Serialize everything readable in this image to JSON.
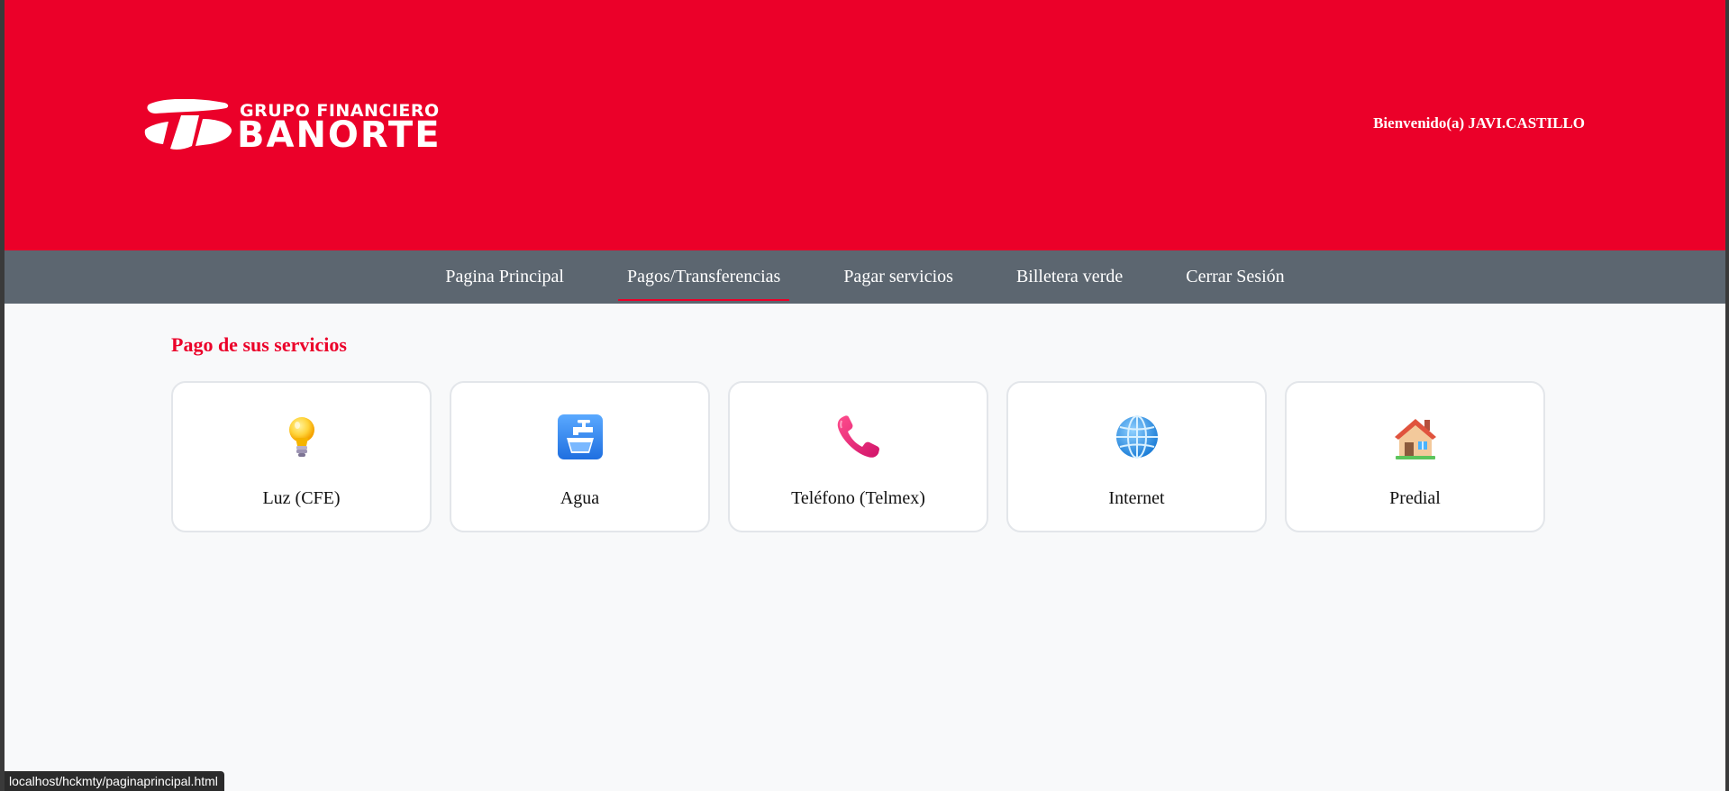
{
  "header": {
    "brand_small": "GRUPO FINANCIERO",
    "brand_big": "BANORTE",
    "welcome": "Bienvenido(a) JAVI.CASTILLO"
  },
  "nav": {
    "items": [
      {
        "label": "Pagina Principal",
        "active": false
      },
      {
        "label": "Pagos/Transferencias",
        "active": true
      },
      {
        "label": "Pagar servicios",
        "active": false
      },
      {
        "label": "Billetera verde",
        "active": false
      },
      {
        "label": "Cerrar Sesión",
        "active": false
      }
    ]
  },
  "main": {
    "title": "Pago de sus servicios",
    "services": [
      {
        "label": "Luz (CFE)",
        "icon": "light-bulb-icon"
      },
      {
        "label": "Agua",
        "icon": "water-faucet-icon"
      },
      {
        "label": "Teléfono (Telmex)",
        "icon": "telephone-icon"
      },
      {
        "label": "Internet",
        "icon": "globe-icon"
      },
      {
        "label": "Predial",
        "icon": "house-icon"
      }
    ]
  },
  "status_bar": {
    "url": "localhost/hckmty/paginaprincipal.html"
  },
  "colors": {
    "brand_red": "#eb0029",
    "nav_gray": "#5c6670",
    "page_bg": "#f8f9fa"
  }
}
